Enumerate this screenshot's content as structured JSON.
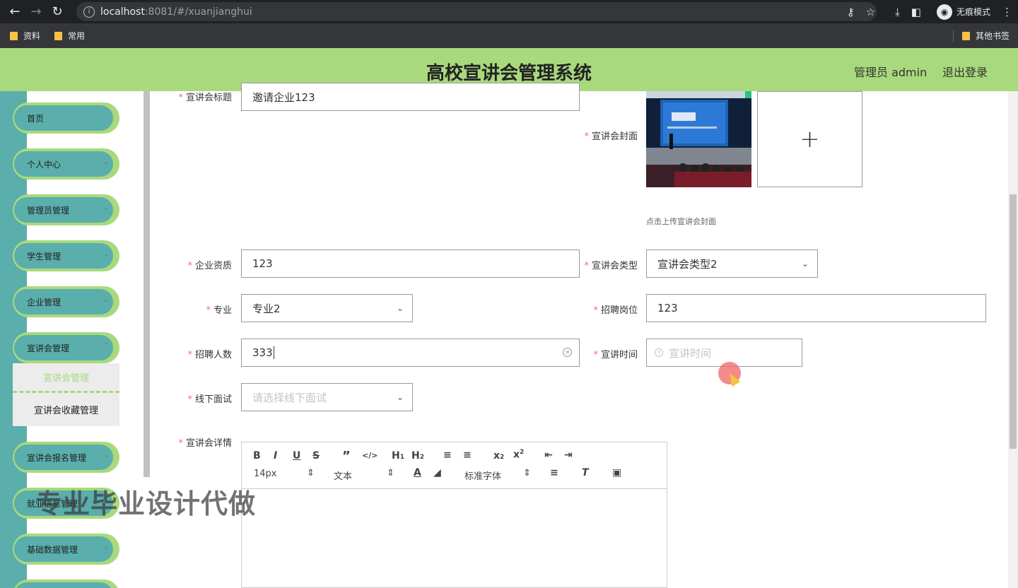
{
  "browser": {
    "url_host": "localhost",
    "url_path": ":8081/#/xuanjianghui",
    "profile_label": "无痕模式",
    "bookmarks": [
      "资料",
      "常用"
    ],
    "other_bookmarks": "其他书签"
  },
  "header": {
    "title": "高校宣讲会管理系统",
    "user": "管理员 admin",
    "logout": "退出登录"
  },
  "sidebar": {
    "items": [
      {
        "label": "首页"
      },
      {
        "label": "个人中心"
      },
      {
        "label": "管理员管理"
      },
      {
        "label": "学生管理"
      },
      {
        "label": "企业管理"
      },
      {
        "label": "宣讲会管理"
      },
      {
        "label": "宣讲会报名管理"
      },
      {
        "label": "就业信息管理"
      },
      {
        "label": "基础数据管理"
      }
    ],
    "submenu": {
      "active": "宣讲会管理",
      "item": "宣讲会收藏管理"
    }
  },
  "form": {
    "title_label": "宣讲会标题",
    "title_value": "邀请企业123",
    "cover_label": "宣讲会封面",
    "cover_tip": "点击上传宣讲会封面",
    "qual_label": "企业资质",
    "qual_value": "123",
    "type_label": "宣讲会类型",
    "type_value": "宣讲会类型2",
    "major_label": "专业",
    "major_value": "专业2",
    "position_label": "招聘岗位",
    "position_value": "123",
    "count_label": "招聘人数",
    "count_value": "333",
    "time_label": "宣讲时间",
    "time_placeholder": "宣讲时间",
    "offline_label": "线下面试",
    "offline_placeholder": "请选择线下面试",
    "detail_label": "宣讲会详情"
  },
  "editor": {
    "size": "14px",
    "header": "文本",
    "font": "标准字体"
  },
  "watermark": "专业毕业设计代做"
}
